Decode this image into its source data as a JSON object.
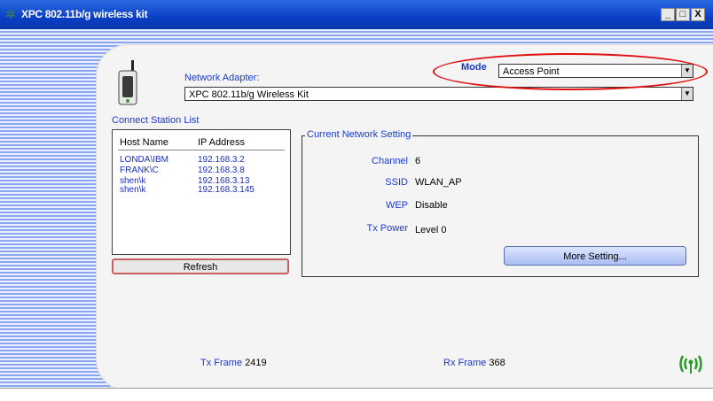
{
  "window": {
    "title": "XPC 802.11b/g wireless kit",
    "minimize": "_",
    "maximize": "□",
    "close": "X"
  },
  "adapter": {
    "label": "Network Adapter:",
    "value": "XPC 802.11b/g Wireless Kit"
  },
  "mode": {
    "label": "Mode",
    "value": "Access Point"
  },
  "stations": {
    "label": "Connect Station List",
    "columns": [
      "Host Name",
      "IP Address"
    ],
    "rows": [
      {
        "host": "LONDA\\IBM",
        "ip": "192.168.3.2"
      },
      {
        "host": "FRANK\\C",
        "ip": "192.168.3.8"
      },
      {
        "host": "shen\\k",
        "ip": "192.168.3.13"
      },
      {
        "host": "shen\\k",
        "ip": "192.168.3.145"
      }
    ],
    "refresh_label": "Refresh"
  },
  "current": {
    "title": "Current Network Setting",
    "fields": [
      {
        "label": "Channel",
        "value": "6"
      },
      {
        "label": "SSID",
        "value": "WLAN_AP"
      },
      {
        "label": "WEP",
        "value": "Disable"
      },
      {
        "label": "Tx Power",
        "value": "Level 0"
      }
    ],
    "more_label": "More Setting..."
  },
  "counters": {
    "tx_label": "Tx Frame",
    "tx_value": "2419",
    "rx_label": "Rx Frame",
    "rx_value": "368"
  },
  "colors": {
    "accent": "#1a3ad0",
    "highlight": "#e01010"
  },
  "icons": {
    "device": "wireless-router-icon",
    "signal": "antenna-signal-icon"
  }
}
